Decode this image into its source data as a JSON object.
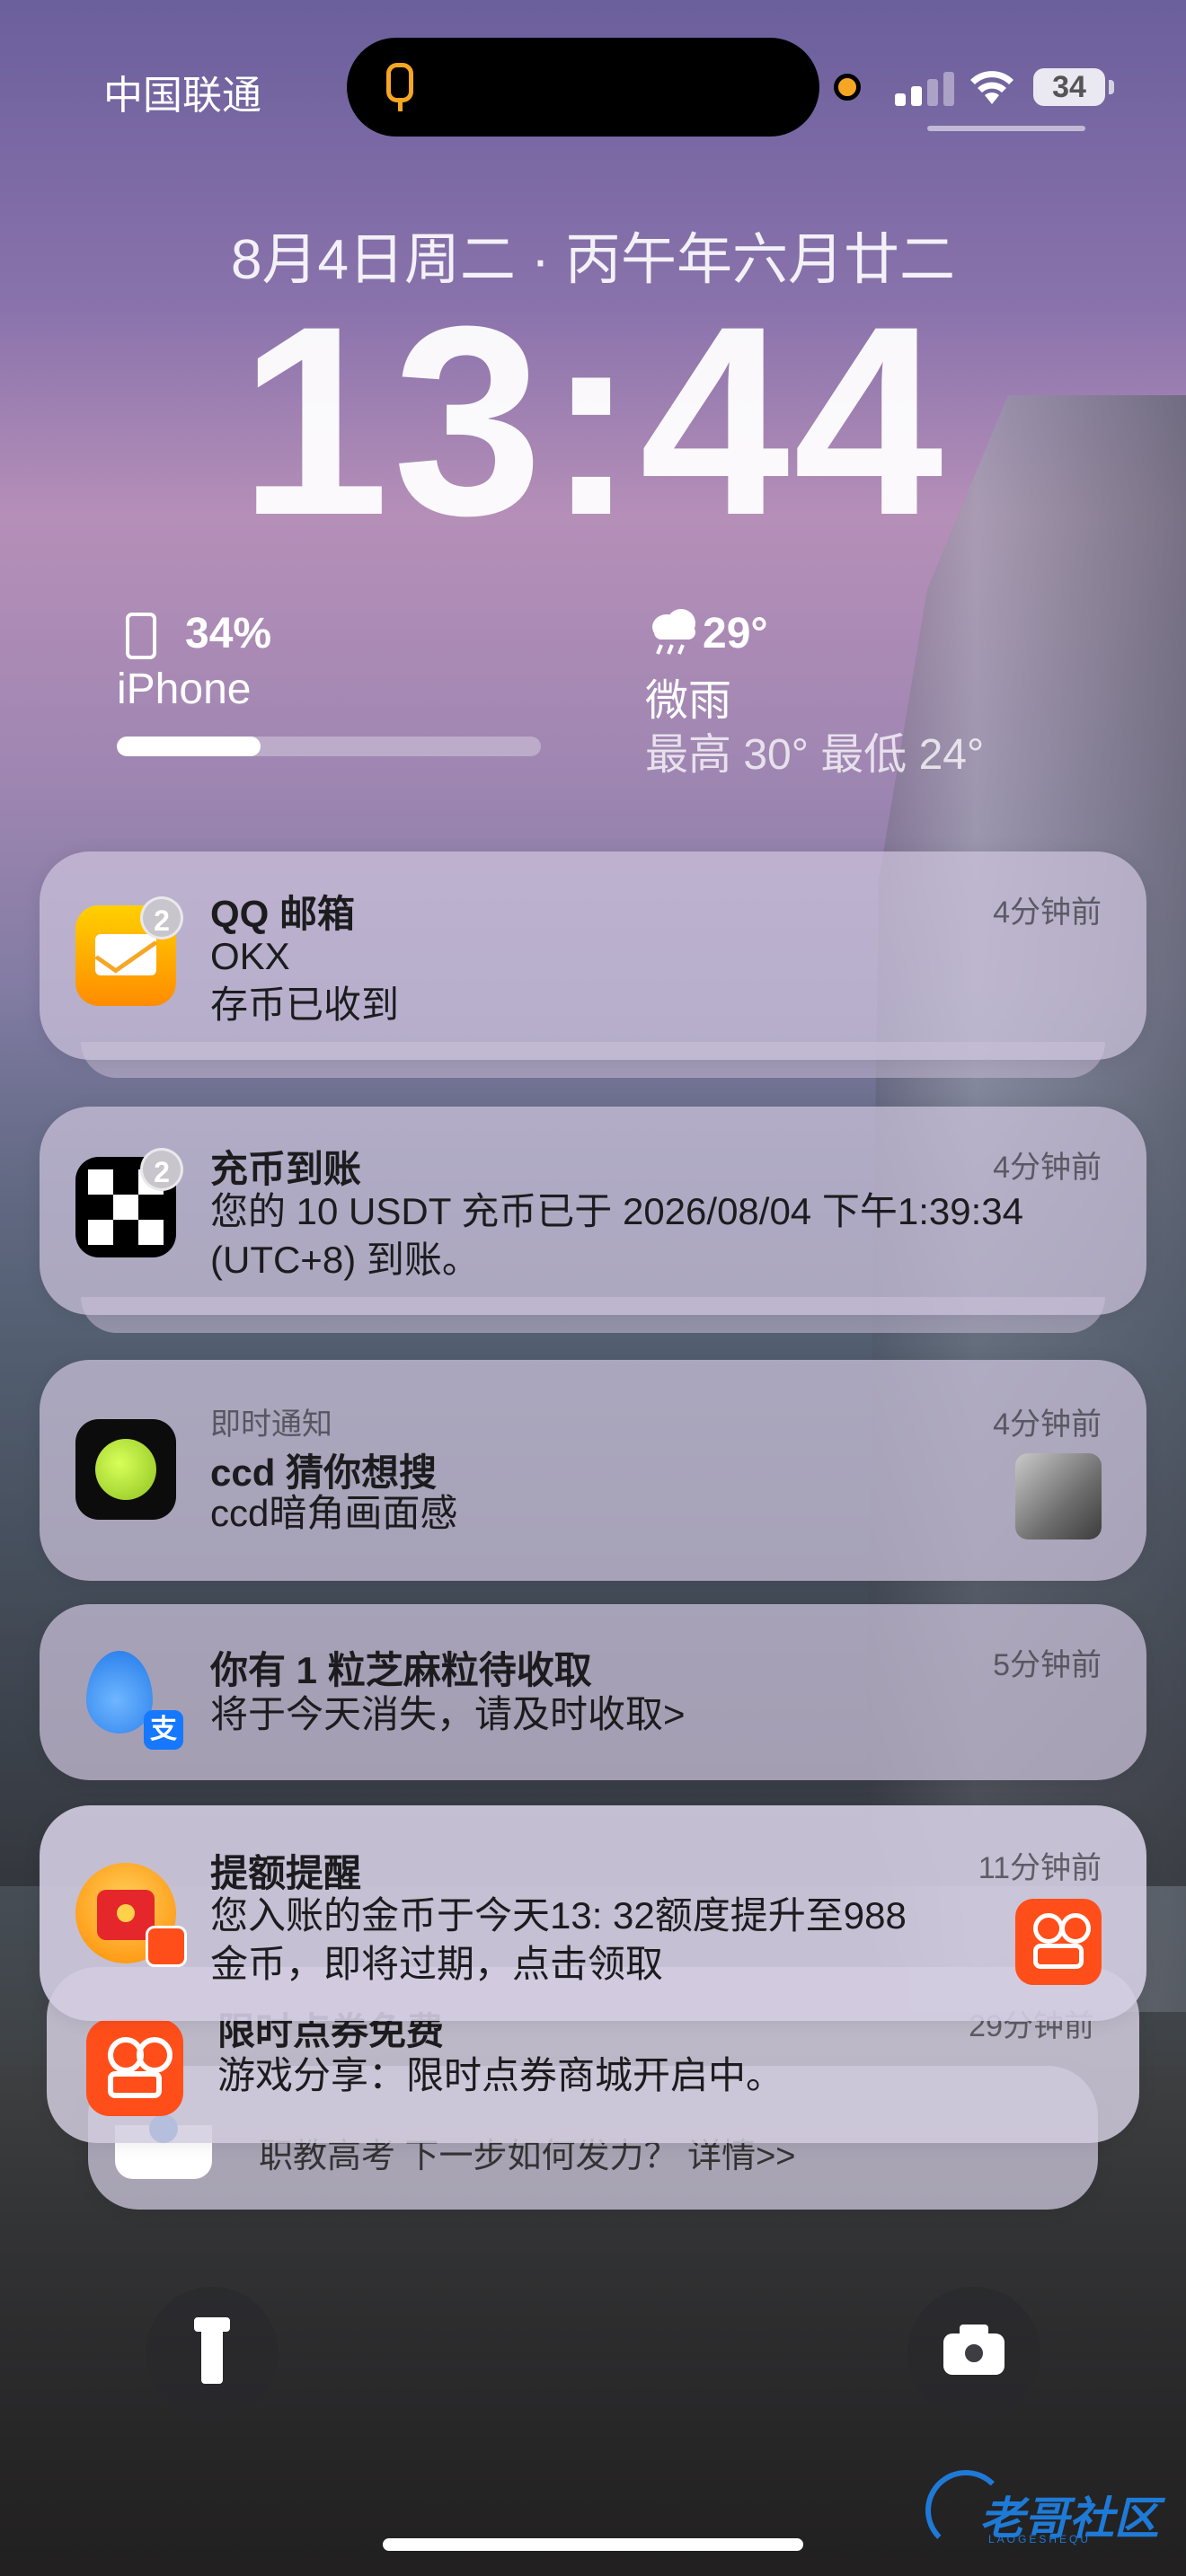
{
  "status_bar": {
    "carrier": "中国联通",
    "battery": "34",
    "mic_color": "#f5a623"
  },
  "lock": {
    "date": "8月4日周二 · 丙午年六月廿二",
    "time": "13:44"
  },
  "widgets": {
    "battery": {
      "percent": "34%",
      "device": "iPhone",
      "level": 0.34
    },
    "weather": {
      "icon": "rain-cloud-icon",
      "temp": "29°",
      "condition": "微雨",
      "range": "最高 30° 最低 24°"
    }
  },
  "notifications": [
    {
      "app": "qq-mail",
      "badge": "2",
      "title": "QQ 邮箱",
      "time": "4分钟前",
      "lines": [
        "OKX",
        "存币已收到"
      ]
    },
    {
      "app": "okx",
      "badge": "2",
      "title": "充币到账",
      "time": "4分钟前",
      "lines": [
        "您的 10 USDT 充币已于 2026/08/04 下午1:39:34",
        "(UTC+8) 到账。"
      ]
    },
    {
      "app": "ccd",
      "label": "即时通知",
      "title": "ccd 猜你想搜",
      "time": "4分钟前",
      "lines": [
        "ccd暗角画面感"
      ]
    },
    {
      "app": "alipay",
      "title": "你有 1 粒芝麻粒待收取",
      "time": "5分钟前",
      "lines": [
        "将于今天消失，请及时收取>"
      ]
    },
    {
      "app": "kuaishou",
      "title": "提额提醒",
      "time": "11分钟前",
      "lines": [
        "您入账的金币于今天13: 32额度提升至988",
        "金币，即将过期，点击领取"
      ]
    },
    {
      "app": "kuaishou",
      "title": "限时点券免费",
      "time": "29分钟前",
      "lines": [
        "游戏分享：限时点券商城开启中。"
      ]
    },
    {
      "app": "education",
      "lines": [
        "职教高考 下一步如何发力？ 详情>>"
      ]
    }
  ],
  "watermark": {
    "text": "老哥社区",
    "sub": "LAOGESHEQU"
  },
  "colors": {
    "qq_mail": "#f5b300",
    "ccd_green": "#b5f23c",
    "alipay_blue": "#1677ff",
    "kuaishou_orange": "#ff4e1a"
  }
}
